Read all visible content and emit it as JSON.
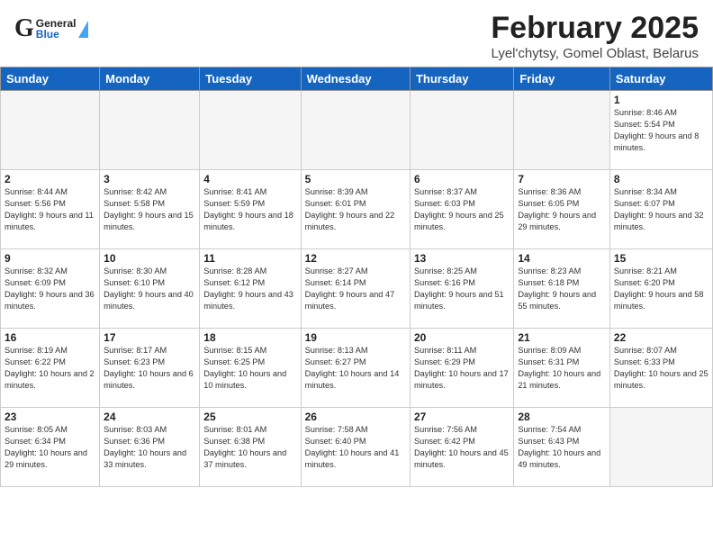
{
  "header": {
    "logo_general": "General",
    "logo_blue": "Blue",
    "title": "February 2025",
    "subtitle": "Lyel'chytsy, Gomel Oblast, Belarus"
  },
  "days_of_week": [
    "Sunday",
    "Monday",
    "Tuesday",
    "Wednesday",
    "Thursday",
    "Friday",
    "Saturday"
  ],
  "weeks": [
    [
      {
        "day": "",
        "info": ""
      },
      {
        "day": "",
        "info": ""
      },
      {
        "day": "",
        "info": ""
      },
      {
        "day": "",
        "info": ""
      },
      {
        "day": "",
        "info": ""
      },
      {
        "day": "",
        "info": ""
      },
      {
        "day": "1",
        "info": "Sunrise: 8:46 AM\nSunset: 5:54 PM\nDaylight: 9 hours and 8 minutes."
      }
    ],
    [
      {
        "day": "2",
        "info": "Sunrise: 8:44 AM\nSunset: 5:56 PM\nDaylight: 9 hours and 11 minutes."
      },
      {
        "day": "3",
        "info": "Sunrise: 8:42 AM\nSunset: 5:58 PM\nDaylight: 9 hours and 15 minutes."
      },
      {
        "day": "4",
        "info": "Sunrise: 8:41 AM\nSunset: 5:59 PM\nDaylight: 9 hours and 18 minutes."
      },
      {
        "day": "5",
        "info": "Sunrise: 8:39 AM\nSunset: 6:01 PM\nDaylight: 9 hours and 22 minutes."
      },
      {
        "day": "6",
        "info": "Sunrise: 8:37 AM\nSunset: 6:03 PM\nDaylight: 9 hours and 25 minutes."
      },
      {
        "day": "7",
        "info": "Sunrise: 8:36 AM\nSunset: 6:05 PM\nDaylight: 9 hours and 29 minutes."
      },
      {
        "day": "8",
        "info": "Sunrise: 8:34 AM\nSunset: 6:07 PM\nDaylight: 9 hours and 32 minutes."
      }
    ],
    [
      {
        "day": "9",
        "info": "Sunrise: 8:32 AM\nSunset: 6:09 PM\nDaylight: 9 hours and 36 minutes."
      },
      {
        "day": "10",
        "info": "Sunrise: 8:30 AM\nSunset: 6:10 PM\nDaylight: 9 hours and 40 minutes."
      },
      {
        "day": "11",
        "info": "Sunrise: 8:28 AM\nSunset: 6:12 PM\nDaylight: 9 hours and 43 minutes."
      },
      {
        "day": "12",
        "info": "Sunrise: 8:27 AM\nSunset: 6:14 PM\nDaylight: 9 hours and 47 minutes."
      },
      {
        "day": "13",
        "info": "Sunrise: 8:25 AM\nSunset: 6:16 PM\nDaylight: 9 hours and 51 minutes."
      },
      {
        "day": "14",
        "info": "Sunrise: 8:23 AM\nSunset: 6:18 PM\nDaylight: 9 hours and 55 minutes."
      },
      {
        "day": "15",
        "info": "Sunrise: 8:21 AM\nSunset: 6:20 PM\nDaylight: 9 hours and 58 minutes."
      }
    ],
    [
      {
        "day": "16",
        "info": "Sunrise: 8:19 AM\nSunset: 6:22 PM\nDaylight: 10 hours and 2 minutes."
      },
      {
        "day": "17",
        "info": "Sunrise: 8:17 AM\nSunset: 6:23 PM\nDaylight: 10 hours and 6 minutes."
      },
      {
        "day": "18",
        "info": "Sunrise: 8:15 AM\nSunset: 6:25 PM\nDaylight: 10 hours and 10 minutes."
      },
      {
        "day": "19",
        "info": "Sunrise: 8:13 AM\nSunset: 6:27 PM\nDaylight: 10 hours and 14 minutes."
      },
      {
        "day": "20",
        "info": "Sunrise: 8:11 AM\nSunset: 6:29 PM\nDaylight: 10 hours and 17 minutes."
      },
      {
        "day": "21",
        "info": "Sunrise: 8:09 AM\nSunset: 6:31 PM\nDaylight: 10 hours and 21 minutes."
      },
      {
        "day": "22",
        "info": "Sunrise: 8:07 AM\nSunset: 6:33 PM\nDaylight: 10 hours and 25 minutes."
      }
    ],
    [
      {
        "day": "23",
        "info": "Sunrise: 8:05 AM\nSunset: 6:34 PM\nDaylight: 10 hours and 29 minutes."
      },
      {
        "day": "24",
        "info": "Sunrise: 8:03 AM\nSunset: 6:36 PM\nDaylight: 10 hours and 33 minutes."
      },
      {
        "day": "25",
        "info": "Sunrise: 8:01 AM\nSunset: 6:38 PM\nDaylight: 10 hours and 37 minutes."
      },
      {
        "day": "26",
        "info": "Sunrise: 7:58 AM\nSunset: 6:40 PM\nDaylight: 10 hours and 41 minutes."
      },
      {
        "day": "27",
        "info": "Sunrise: 7:56 AM\nSunset: 6:42 PM\nDaylight: 10 hours and 45 minutes."
      },
      {
        "day": "28",
        "info": "Sunrise: 7:54 AM\nSunset: 6:43 PM\nDaylight: 10 hours and 49 minutes."
      },
      {
        "day": "",
        "info": ""
      }
    ]
  ]
}
